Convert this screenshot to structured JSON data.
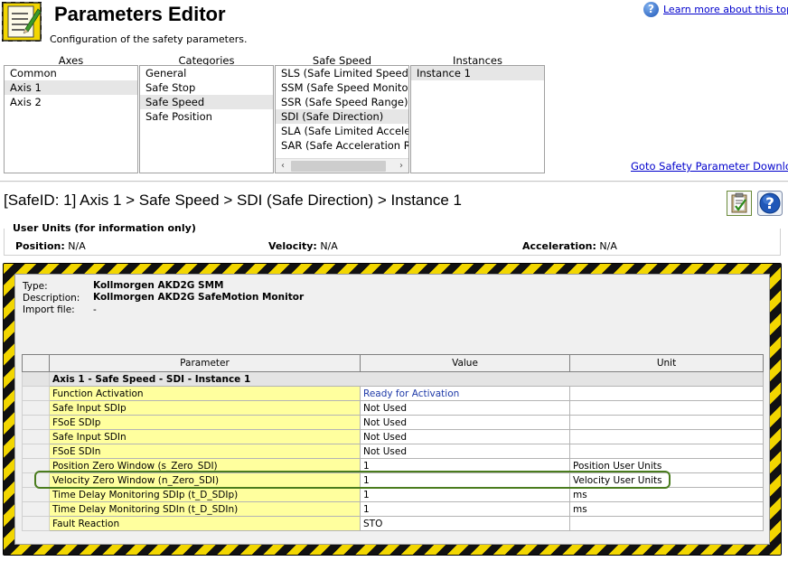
{
  "header": {
    "title": "Parameters Editor",
    "subtitle": "Configuration of the safety parameters.",
    "help_link": "Learn more about this topic"
  },
  "columns": {
    "axes": {
      "title": "Axes",
      "items": [
        "Common",
        "Axis 1",
        "Axis 2"
      ],
      "selected": "Axis 1"
    },
    "categories": {
      "title": "Categories",
      "items": [
        "General",
        "Safe Stop",
        "Safe Speed",
        "Safe Position"
      ],
      "selected": "Safe Speed"
    },
    "safe_speed": {
      "title": "Safe Speed",
      "items": [
        "SLS (Safe Limited Speed)",
        "SSM (Safe Speed Monitor)",
        "SSR (Safe Speed Range)",
        "SDI (Safe Direction)",
        "SLA (Safe Limited Acceleration)",
        "SAR (Safe Acceleration Range)"
      ],
      "selected": "SDI (Safe Direction)"
    },
    "instances": {
      "title": "Instances",
      "items": [
        "Instance 1"
      ],
      "selected": "Instance 1"
    }
  },
  "download_link": "Goto Safety Parameter Download",
  "breadcrumb": "[SafeID: 1]  Axis 1 > Safe Speed > SDI (Safe Direction) > Instance 1",
  "user_units": {
    "legend": "User Units (for information only)",
    "position_label": "Position:",
    "position_value": "N/A",
    "velocity_label": "Velocity:",
    "velocity_value": "N/A",
    "acceleration_label": "Acceleration:",
    "acceleration_value": "N/A"
  },
  "device": {
    "type_label": "Type:",
    "type_value": "Kollmorgen AKD2G SMM",
    "description_label": "Description:",
    "description_value": "Kollmorgen AKD2G SafeMotion Monitor",
    "import_label": "Import file:",
    "import_value": "-"
  },
  "grid": {
    "headers": {
      "parameter": "Parameter",
      "value": "Value",
      "unit": "Unit"
    },
    "group": "Axis 1 - Safe Speed - SDI - Instance 1",
    "rows": [
      {
        "parameter": "Function Activation",
        "value": "Ready for Activation",
        "unit": ""
      },
      {
        "parameter": "Safe Input SDIp",
        "value": "Not Used",
        "unit": ""
      },
      {
        "parameter": "FSoE SDIp",
        "value": "Not Used",
        "unit": ""
      },
      {
        "parameter": "Safe Input SDIn",
        "value": "Not Used",
        "unit": ""
      },
      {
        "parameter": "FSoE SDIn",
        "value": "Not Used",
        "unit": ""
      },
      {
        "parameter": "Position Zero Window (s_Zero_SDI)",
        "value": "1",
        "unit": "Position User Units"
      },
      {
        "parameter": "Velocity Zero Window (n_Zero_SDI)",
        "value": "1",
        "unit": "Velocity User Units"
      },
      {
        "parameter": "Time Delay Monitoring SDIp (t_D_SDIp)",
        "value": "1",
        "unit": "ms"
      },
      {
        "parameter": "Time Delay Monitoring SDIn (t_D_SDIn)",
        "value": "1",
        "unit": "ms"
      },
      {
        "parameter": "Fault Reaction",
        "value": "STO",
        "unit": ""
      }
    ]
  },
  "icons": {
    "app": "notepad-edit-icon",
    "help": "help-icon",
    "clipboard": "clipboard-check-icon"
  },
  "colors": {
    "link": "#0000cc",
    "param_cell": "#ffff9e",
    "hazard_yellow": "#f2d600",
    "highlight": "#4a7c1e",
    "value_blue": "#1f3aa8"
  }
}
